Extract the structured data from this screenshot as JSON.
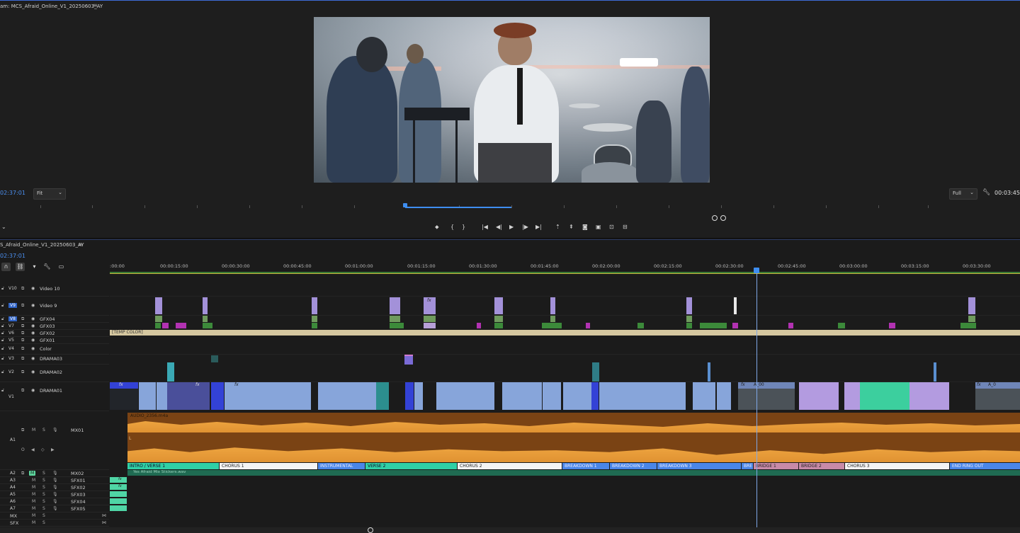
{
  "monitor": {
    "title": "am: MCS_Afraid_Online_V1_20250603_AY",
    "menu_icon": "hamburger-icon",
    "timecode_left": "02:37:01",
    "fit": "Fit",
    "resolution": "Full",
    "timecode_right": "00:03:45:"
  },
  "timeline": {
    "title": "S_Afraid_Online_V1_20250603_AY",
    "timecode": "02:37:01",
    "ruler": [
      ":00:00",
      "00:00:15:00",
      "00:00:30:00",
      "00:00:45:00",
      "00:01:00:00",
      "00:01:15:00",
      "00:01:30:00",
      "00:01:45:00",
      "00:02:00:00",
      "00:02:15:00",
      "00:02:30:00",
      "00:02:45:00",
      "00:03:00:00",
      "00:03:15:00",
      "00:03:30:00"
    ],
    "video_tracks": [
      {
        "id": "V10",
        "name": "Video 10"
      },
      {
        "id": "V9",
        "name": "Video 9"
      },
      {
        "id": "V8",
        "name": "GFX04"
      },
      {
        "id": "V7",
        "name": "GFX03"
      },
      {
        "id": "V6",
        "name": "GFX02"
      },
      {
        "id": "V5",
        "name": "GFX01"
      },
      {
        "id": "V4",
        "name": "Color"
      },
      {
        "id": "V3",
        "name": "DRAMA03"
      },
      {
        "id": "V2",
        "name": "DRAMA02"
      },
      {
        "id": "V1",
        "name": "DRAMA01"
      }
    ],
    "audio_tracks": [
      {
        "id": "A1",
        "name": "MX01"
      },
      {
        "id": "A2",
        "name": "MX02"
      },
      {
        "id": "A3",
        "name": "SFX01"
      },
      {
        "id": "A4",
        "name": "SFX02"
      },
      {
        "id": "A5",
        "name": "SFX03"
      },
      {
        "id": "A6",
        "name": "SFX04"
      },
      {
        "id": "A7",
        "name": "SFX05"
      },
      {
        "id": "",
        "name": "MX"
      },
      {
        "id": "",
        "name": "SFX"
      }
    ],
    "temp_color_label": "[TEMP COLOR]",
    "audio_clip_name": "AUDIO_2356.m4a",
    "audio_channel_label": "L",
    "mx02_clip_name": "Yes Afraid Mix Stickers.wav",
    "markers": [
      {
        "label": "INTRO / VERSE 1",
        "color": "#2fd0a6"
      },
      {
        "label": "CHORUS 1",
        "color": "#f4f4f4"
      },
      {
        "label": "INSTRUMENTAL",
        "color": "#4a86e8"
      },
      {
        "label": "VERSE 2",
        "color": "#2fd0a6"
      },
      {
        "label": "CHORUS 2",
        "color": "#f4f4f4"
      },
      {
        "label": "BREAKDOWN 1",
        "color": "#4a86e8"
      },
      {
        "label": "BREAKDOWN 2",
        "color": "#4a86e8"
      },
      {
        "label": "BREAKDOWN 3",
        "color": "#4a86e8"
      },
      {
        "label": "BRE",
        "color": "#4a86e8"
      },
      {
        "label": "BRIDGE 1",
        "color": "#c88aa8"
      },
      {
        "label": "BRIDGE 2",
        "color": "#c88aa8"
      },
      {
        "label": "CHORUS 3",
        "color": "#f4f4f4"
      },
      {
        "label": "END RING OUT",
        "color": "#4a86e8"
      }
    ],
    "fx_label": "fx",
    "v1_clip_label_a": "A_00",
    "v1_clip_label_b": "A_0",
    "track_buttons": {
      "m": "M",
      "s": "S",
      "o": "O"
    }
  }
}
